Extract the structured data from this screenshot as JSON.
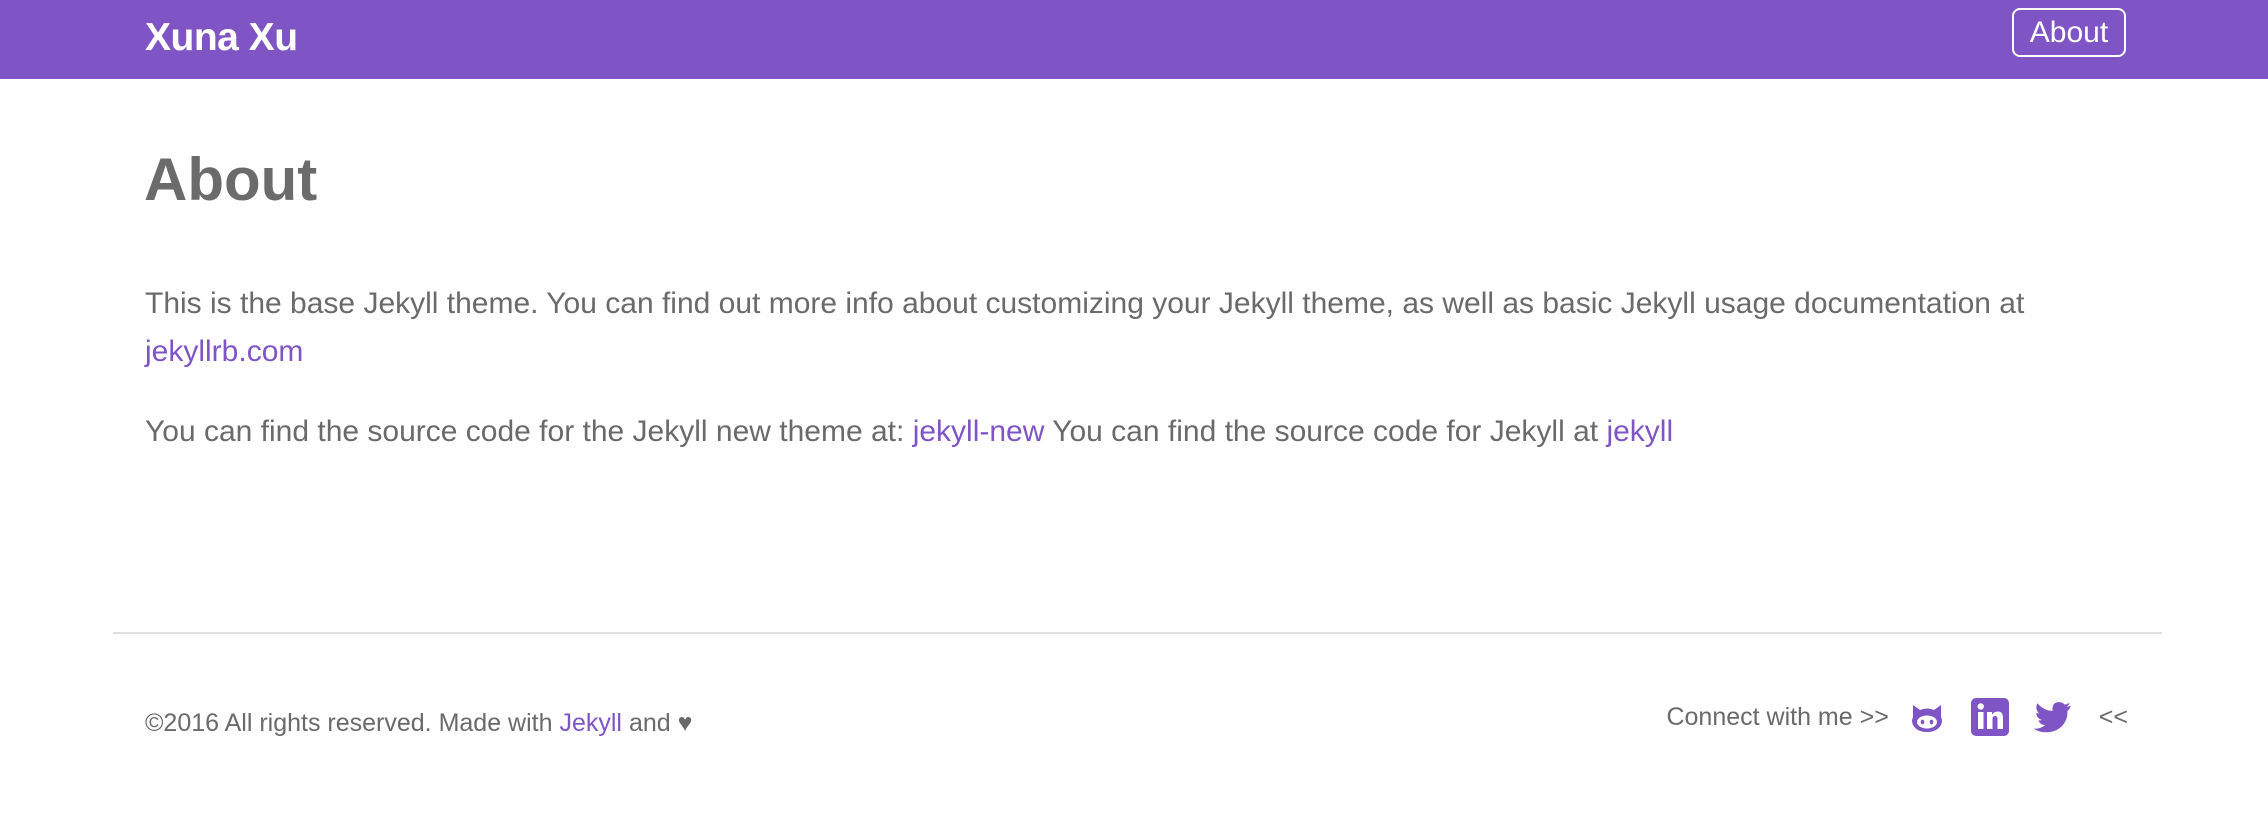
{
  "colors": {
    "brand": "#7f55c6",
    "text": "#6a6a6a",
    "header_text": "#ffffff",
    "rule": "#e0e0e0"
  },
  "header": {
    "site_title": "Xuna Xu",
    "nav": {
      "about_label": "About"
    }
  },
  "main": {
    "title": "About",
    "para1_text": "This is the base Jekyll theme. You can find out more info about customizing your Jekyll theme, as well as basic Jekyll usage documentation at",
    "para1_link": "jekyllrb.com",
    "para2_text_a": "You can find the source code for the Jekyll new theme at:",
    "para2_link_a": "jekyll-new",
    "para2_text_b": "You can find the source code for Jekyll at",
    "para2_link_b": "jekyll"
  },
  "footer": {
    "copyright_prefix": "©2016 All rights reserved. Made with",
    "jekyll_link": "Jekyll",
    "suffix": "and ♥",
    "connect_label": "Connect with me >>",
    "end_marker": "<<",
    "social_icons": [
      "github-icon",
      "linkedin-icon",
      "twitter-icon"
    ]
  }
}
